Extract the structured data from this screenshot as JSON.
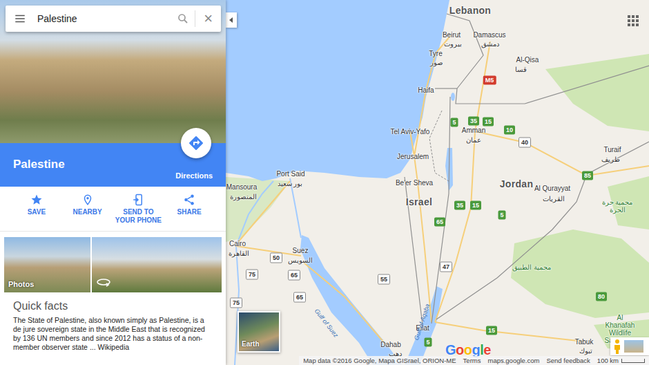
{
  "search": {
    "value": "Palestine",
    "clear": "×"
  },
  "place": {
    "title": "Palestine",
    "directions": "Directions"
  },
  "actions": [
    {
      "label": "SAVE"
    },
    {
      "label": "NEARBY"
    },
    {
      "label": "SEND TO YOUR PHONE"
    },
    {
      "label": "SHARE"
    }
  ],
  "photos": {
    "label": "Photos"
  },
  "quick_facts": {
    "title": "Quick facts",
    "text": "The State of Palestine, also known simply as Palestine, is a de jure sovereign state in the Middle East that is recognized by 136 UN members and since 2012 has a status of a non-member observer state ... Wikipedia"
  },
  "map": {
    "labels": [
      {
        "text": "Lebanon",
        "kind": "country"
      },
      {
        "text": "Beirut",
        "kind": "city"
      },
      {
        "text": "بيروت",
        "kind": "city"
      },
      {
        "text": "Damascus",
        "kind": "city"
      },
      {
        "text": "دمشق",
        "kind": "city"
      },
      {
        "text": "Al-Qisa",
        "kind": "city"
      },
      {
        "text": "قسا",
        "kind": "city"
      },
      {
        "text": "Tyre",
        "kind": "city"
      },
      {
        "text": "صور",
        "kind": "city"
      },
      {
        "text": "Haifa",
        "kind": "city"
      },
      {
        "text": "Tel Aviv-Yafo",
        "kind": "city"
      },
      {
        "text": "Amman",
        "kind": "city"
      },
      {
        "text": "عمان",
        "kind": "city"
      },
      {
        "text": "Jerusalem",
        "kind": "city"
      },
      {
        "text": "Be'er Sheva",
        "kind": "city"
      },
      {
        "text": "Israel",
        "kind": "country"
      },
      {
        "text": "Jordan",
        "kind": "country"
      },
      {
        "text": "Turaif",
        "kind": "city"
      },
      {
        "text": "طريف",
        "kind": "city"
      },
      {
        "text": "Al Qurayyat",
        "kind": "city"
      },
      {
        "text": "القريات",
        "kind": "city"
      },
      {
        "text": "محمية حرة الحرة",
        "kind": "park"
      },
      {
        "text": "Port Said",
        "kind": "city"
      },
      {
        "text": "بور سعيد",
        "kind": "city"
      },
      {
        "text": "Mansoura",
        "kind": "city"
      },
      {
        "text": "المنصورة",
        "kind": "city"
      },
      {
        "text": "Cairo",
        "kind": "city"
      },
      {
        "text": "القاهرة",
        "kind": "city"
      },
      {
        "text": "Suez",
        "kind": "city"
      },
      {
        "text": "السويس",
        "kind": "city"
      },
      {
        "text": "Eilat",
        "kind": "city"
      },
      {
        "text": "محمية الطبيق",
        "kind": "park"
      },
      {
        "text": "Gulf of Suez",
        "kind": "water"
      },
      {
        "text": "Gulf of Aqaba",
        "kind": "water"
      },
      {
        "text": "Dahab",
        "kind": "city"
      },
      {
        "text": "دهب",
        "kind": "city"
      },
      {
        "text": "Al Khanafah Wildlife Sanctuary",
        "kind": "park"
      },
      {
        "text": "Tabuk",
        "kind": "city"
      },
      {
        "text": "تبوك",
        "kind": "city"
      }
    ],
    "shields": [
      {
        "text": "M5",
        "kind": "red"
      },
      {
        "text": "5",
        "kind": "green"
      },
      {
        "text": "35",
        "kind": "green"
      },
      {
        "text": "15",
        "kind": "green"
      },
      {
        "text": "10",
        "kind": "green"
      },
      {
        "text": "40",
        "kind": "white"
      },
      {
        "text": "65",
        "kind": "green"
      },
      {
        "text": "35",
        "kind": "green"
      },
      {
        "text": "15",
        "kind": "green"
      },
      {
        "text": "5",
        "kind": "green"
      },
      {
        "text": "47",
        "kind": "white"
      },
      {
        "text": "50",
        "kind": "white"
      },
      {
        "text": "75",
        "kind": "white"
      },
      {
        "text": "65",
        "kind": "white"
      },
      {
        "text": "55",
        "kind": "white"
      },
      {
        "text": "65",
        "kind": "white"
      },
      {
        "text": "75",
        "kind": "white"
      },
      {
        "text": "15",
        "kind": "green"
      },
      {
        "text": "5",
        "kind": "green"
      },
      {
        "text": "85",
        "kind": "green"
      },
      {
        "text": "80",
        "kind": "green"
      }
    ],
    "earth": "Earth",
    "logo": "Google",
    "footer": [
      "Map data ©2016 Google, Mapa GISrael, ORION-ME",
      "Terms",
      "maps.google.com",
      "Send feedback"
    ],
    "scale": "100 km"
  }
}
